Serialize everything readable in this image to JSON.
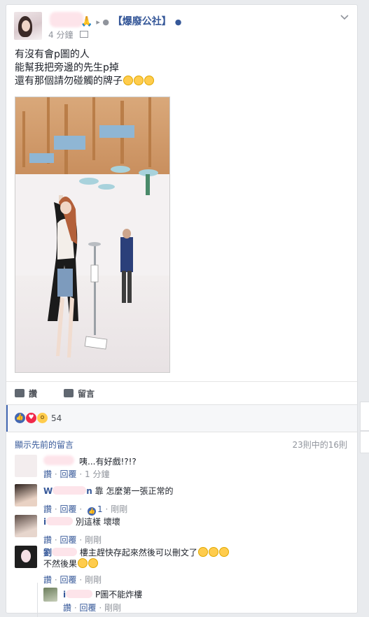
{
  "post": {
    "author_visible": "🙏",
    "group_sep": "▸ ●",
    "group_name": "【爆廢公社】",
    "dot": "●",
    "time": "4 分鐘",
    "privacy_icon": "group-icon",
    "message": [
      "有沒有會p圖的人",
      "能幫我把旁邊的先生p掉",
      "還有那個請勿碰觸的牌子"
    ],
    "message_emoji_count": 3
  },
  "actions": {
    "like": "讚",
    "comment": "留言"
  },
  "reactions": {
    "count": "54",
    "types": [
      "like",
      "love",
      "wow"
    ],
    "accent": "#4267b2"
  },
  "comments_meta": {
    "previous": "顯示先前的留言",
    "pager": "23則中的16則"
  },
  "comment_labels": {
    "like": "讚",
    "reply": "回覆",
    "dot": "·"
  },
  "comments": [
    {
      "name_visible": "",
      "text": "咦...有好戲!?!?",
      "time": "1 分鐘",
      "likes": ""
    },
    {
      "name_visible": "W",
      "name_tail": "n",
      "text": "靠 怎麼第一張正常的",
      "time": "剛剛",
      "likes": "1"
    },
    {
      "name_visible": "i",
      "text": "別這樣 壞壞",
      "time": "剛剛",
      "likes": ""
    },
    {
      "name_visible": "劉",
      "text": "樓主趕快存起來然後可以刪文了",
      "text2": "不然後果",
      "time": "剛剛",
      "likes": ""
    }
  ],
  "reply": {
    "name_visible": "i",
    "text": "P圖不能炸樓",
    "time": "剛剛"
  }
}
